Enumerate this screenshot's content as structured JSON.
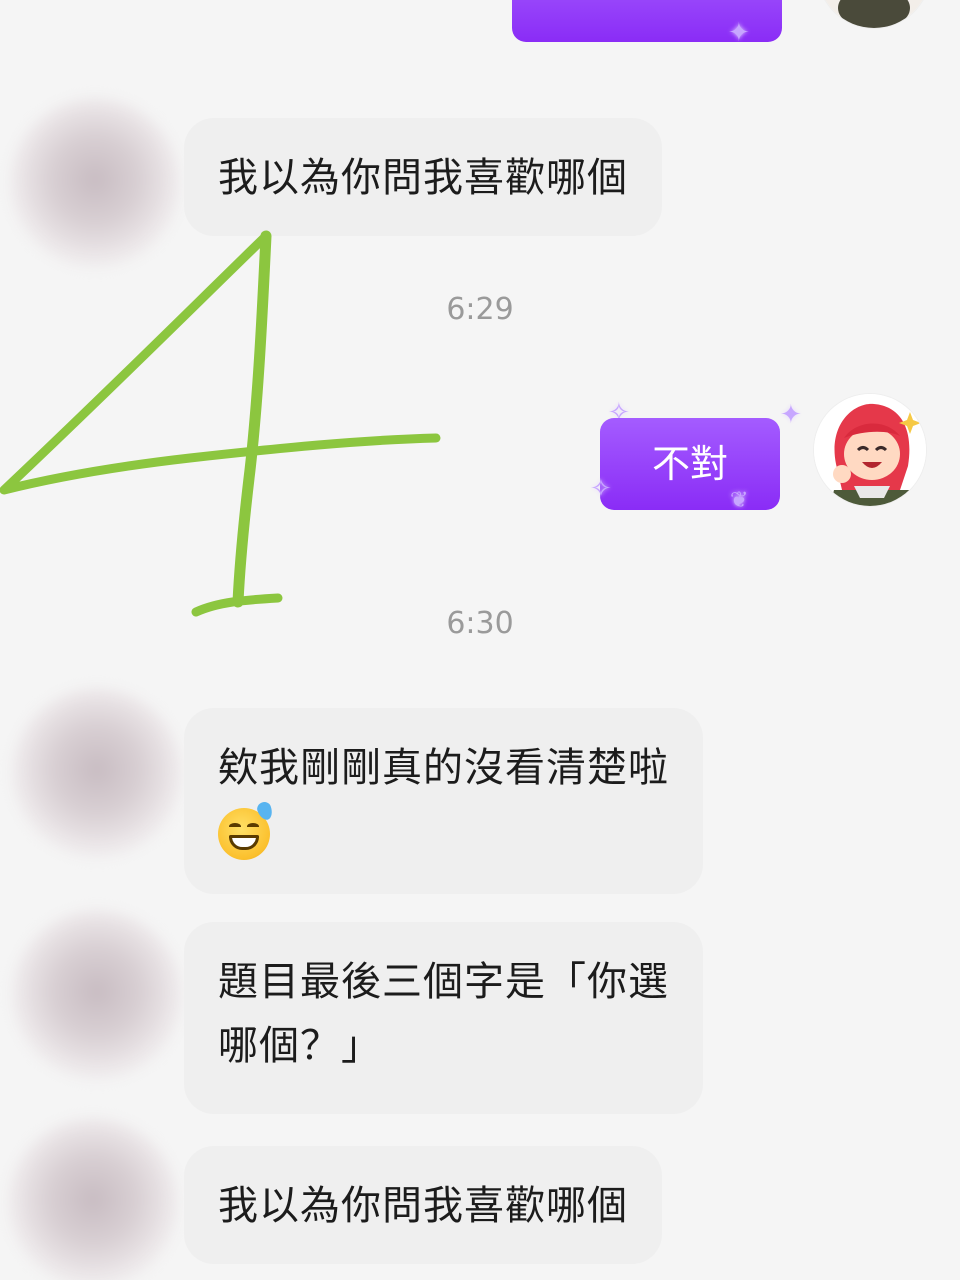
{
  "messages": [
    {
      "type": "incoming",
      "lines": [
        "我以為你問我喜歡哪個"
      ]
    },
    {
      "type": "timestamp",
      "text": "6:29"
    },
    {
      "type": "outgoing",
      "text": "不對"
    },
    {
      "type": "timestamp",
      "text": "6:30"
    },
    {
      "type": "incoming",
      "lines": [
        "欸我剛剛真的沒看清楚啦"
      ],
      "emoji": "grinning-face-with-sweat"
    },
    {
      "type": "incoming",
      "lines": [
        "題目最後三個字是「你選",
        "哪個？」"
      ]
    },
    {
      "type": "incoming",
      "lines": [
        "我以為你問我喜歡哪個"
      ]
    }
  ],
  "annotation": {
    "text": "4",
    "color": "#8cc63f"
  },
  "colors": {
    "background": "#f5f5f5",
    "incoming_bubble": "#efefef",
    "outgoing_bubble": "#9446fa",
    "timestamp": "#9a9a9a"
  },
  "icons": {
    "incoming_avatar": "blurred-avatar-icon",
    "outgoing_avatar": "red-hair-thumbs-up-sticker-icon"
  }
}
